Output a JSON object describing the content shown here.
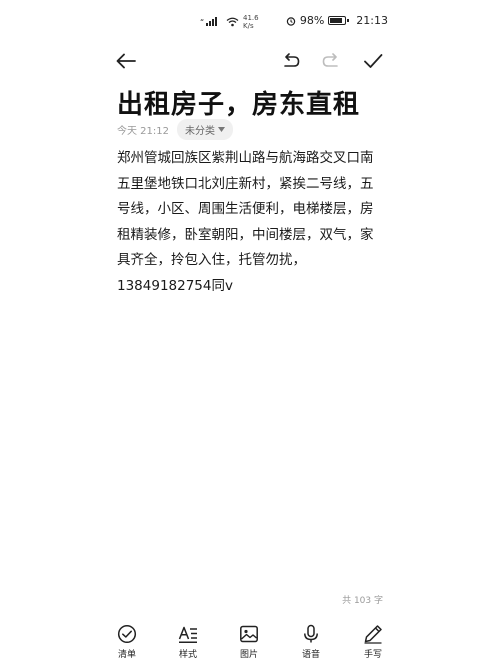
{
  "status_bar": {
    "net_speed_value": "41.6",
    "net_speed_unit": "K/s",
    "battery": "98%",
    "time": "21:13"
  },
  "note": {
    "title": "出租房子，房东直租",
    "date": "今天 21:12",
    "category": "未分类",
    "body_lines": [
      "郑州管城回族区紫荆山路与航海路交叉口南",
      "五里堡地铁口北刘庄新村，紧挨二号线，五",
      "号线，小区、周围生活便利，电梯楼层，房",
      "租精装修，卧室朝阳，中间楼层，双气，家",
      "具齐全，拎包入住，托管勿扰，",
      "13849182754同v"
    ],
    "word_count": "共 103 字"
  },
  "bottom_bar": {
    "checklist": "清单",
    "style": "样式",
    "image": "图片",
    "voice": "语音",
    "handwrite": "手写"
  },
  "colors": {
    "text": "#1a1a1a",
    "muted": "#9a9a9a",
    "chip_bg": "#f0f0f0"
  }
}
